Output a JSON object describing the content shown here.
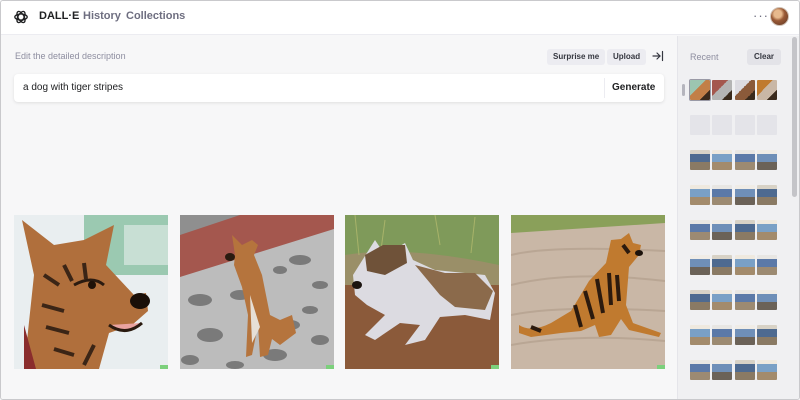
{
  "app": {
    "brand": "DALL·E",
    "nav": {
      "history": "History",
      "collections": "Collections"
    },
    "more_label": "···"
  },
  "prompt": {
    "label": "Edit the detailed description",
    "surprise_label": "Surprise me",
    "upload_label": "Upload",
    "value": "a dog with tiger stripes",
    "generate_label": "Generate"
  },
  "results": [
    {
      "subject": "dog-closeup-tiger-stripes"
    },
    {
      "subject": "dog-sitting-spotted-pavement"
    },
    {
      "subject": "dog-lying-on-dirt"
    },
    {
      "subject": "dog-tiger-striped-sitting-sand"
    }
  ],
  "sidebar": {
    "recent_label": "Recent",
    "clear_label": "Clear",
    "rows": [
      {
        "kind": "dogs",
        "count": 4
      },
      {
        "kind": "placeholder",
        "count": 4
      },
      {
        "kind": "interior",
        "count": 4
      },
      {
        "kind": "interior",
        "count": 4
      },
      {
        "kind": "interior",
        "count": 4
      },
      {
        "kind": "interior",
        "count": 4
      },
      {
        "kind": "interior",
        "count": 4
      },
      {
        "kind": "interior",
        "count": 4
      },
      {
        "kind": "interior",
        "count": 4
      }
    ]
  },
  "colors": {
    "accent": "#202123",
    "muted": "#8e8ea0",
    "background": "#f7f7f8"
  }
}
